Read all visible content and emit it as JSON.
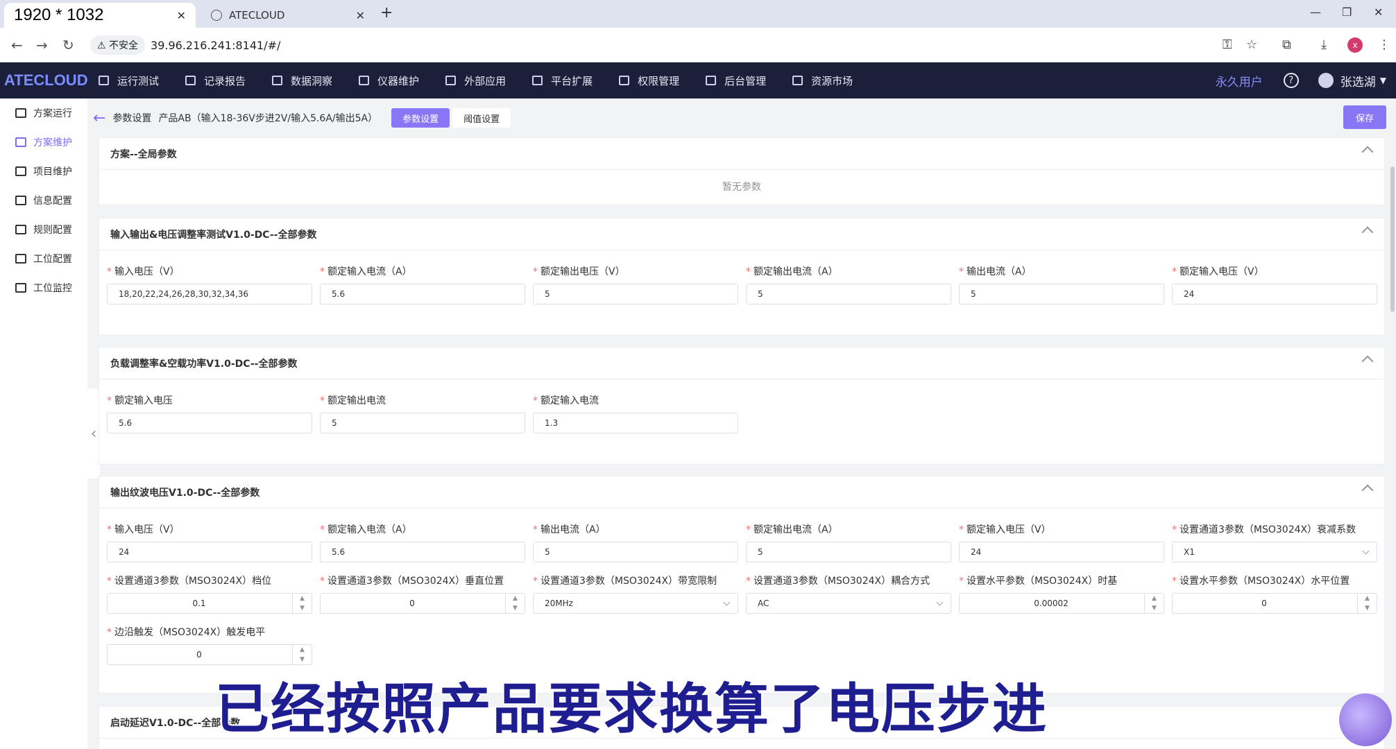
{
  "browser": {
    "active_tab_title": "1920 * 1032",
    "inactive_tab_title": "ATECLOUD",
    "insecure_label": "不安全",
    "url": "39.96.216.241:8141/#/",
    "profile_initial": "x"
  },
  "header": {
    "logo": "ATECLOUD",
    "nav": [
      "运行测试",
      "记录报告",
      "数据洞察",
      "仪器维护",
      "外部应用",
      "平台扩展",
      "权限管理",
      "后台管理",
      "资源市场"
    ],
    "license": "永久用户",
    "help": "?",
    "username": "张选湖"
  },
  "sidebar": {
    "items": [
      "方案运行",
      "方案维护",
      "项目维护",
      "信息配置",
      "规则配置",
      "工位配置",
      "工位监控"
    ],
    "active_index": 1
  },
  "breadcrumb": {
    "root": "参数设置",
    "product": "产品AB（输入18-36V步进2V/输入5.6A/输出5A）",
    "tab_params": "参数设置",
    "tab_threshold": "阈值设置",
    "save": "保存"
  },
  "sections": {
    "global": {
      "title": "方案--全局参数",
      "empty": "暂无参数"
    },
    "s1": {
      "title": "输入输出&电压调整率测试V1.0-DC--全部参数",
      "fields": [
        {
          "label": "输入电压（V）",
          "value": "18,20,22,24,26,28,30,32,34,36"
        },
        {
          "label": "额定输入电流（A）",
          "value": "5.6"
        },
        {
          "label": "额定输出电压（V）",
          "value": "5"
        },
        {
          "label": "额定输出电流（A）",
          "value": "5"
        },
        {
          "label": "输出电流（A）",
          "value": "5"
        },
        {
          "label": "额定输入电压（V）",
          "value": "24"
        }
      ]
    },
    "s2": {
      "title": "负载调整率&空载功率V1.0-DC--全部参数",
      "fields": [
        {
          "label": "额定输入电压",
          "value": "5.6"
        },
        {
          "label": "额定输出电流",
          "value": "5"
        },
        {
          "label": "额定输入电流",
          "value": "1.3"
        }
      ]
    },
    "s3": {
      "title": "输出纹波电压V1.0-DC--全部参数",
      "row1": [
        {
          "label": "输入电压（V）",
          "value": "24"
        },
        {
          "label": "额定输入电流（A）",
          "value": "5.6"
        },
        {
          "label": "输出电流（A）",
          "value": "5"
        },
        {
          "label": "额定输出电流（A）",
          "value": "5"
        },
        {
          "label": "额定输入电压（V）",
          "value": "24"
        },
        {
          "label": "设置通道3参数（MSO3024X）衰减系数",
          "value": "X1"
        }
      ],
      "row2": [
        {
          "label": "设置通道3参数（MSO3024X）档位",
          "value": "0.1"
        },
        {
          "label": "设置通道3参数（MSO3024X）垂直位置",
          "value": "0"
        },
        {
          "label": "设置通道3参数（MSO3024X）带宽限制",
          "value": "20MHz"
        },
        {
          "label": "设置通道3参数（MSO3024X）耦合方式",
          "value": "AC"
        },
        {
          "label": "设置水平参数（MSO3024X）时基",
          "value": "0.00002"
        },
        {
          "label": "设置水平参数（MSO3024X）水平位置",
          "value": "0"
        }
      ],
      "row3": [
        {
          "label": "边沿触发（MSO3024X）触发电平",
          "value": "0"
        }
      ]
    },
    "s4": {
      "title": "启动延迟V1.0-DC--全部参数"
    }
  },
  "subtitle": "已经按照产品要求换算了电压步进",
  "accent_color": "#8876f4"
}
